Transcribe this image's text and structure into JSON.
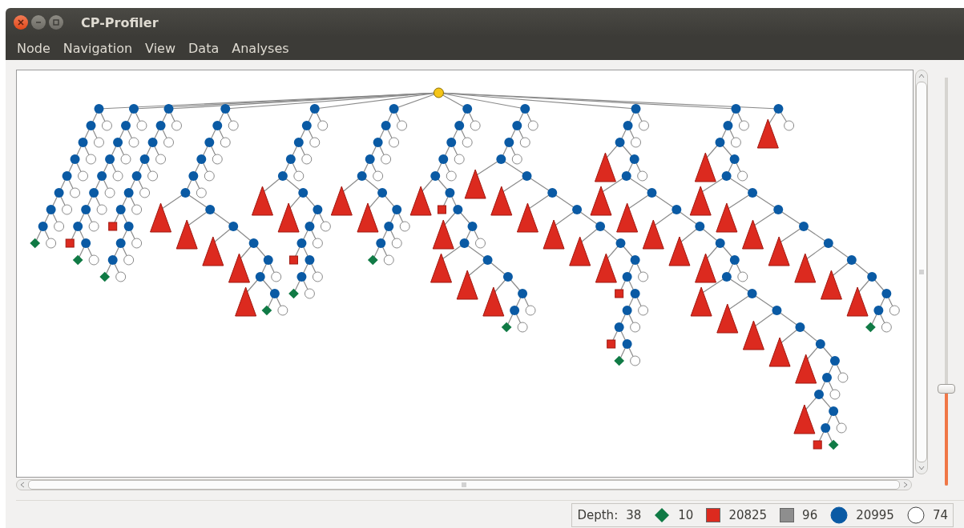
{
  "window": {
    "title": "CP-Profiler"
  },
  "menu": [
    {
      "label": "Node"
    },
    {
      "label": "Navigation"
    },
    {
      "label": "View"
    },
    {
      "label": "Data"
    },
    {
      "label": "Analyses"
    }
  ],
  "zoom_slider": {
    "level": 0.24
  },
  "status_bar": {
    "depth_label": "Depth:",
    "depth": "38",
    "legend": [
      {
        "kind": "solution",
        "color": "#107a45",
        "count": "10"
      },
      {
        "kind": "failure",
        "color": "#dc2a1f",
        "count": "20825"
      },
      {
        "kind": "skipped",
        "color": "#8e8e8e",
        "count": "96"
      },
      {
        "kind": "branch",
        "color": "#0a5aa4",
        "count": "20995"
      },
      {
        "kind": "open",
        "color": "#ffffff",
        "count": "74"
      }
    ]
  }
}
